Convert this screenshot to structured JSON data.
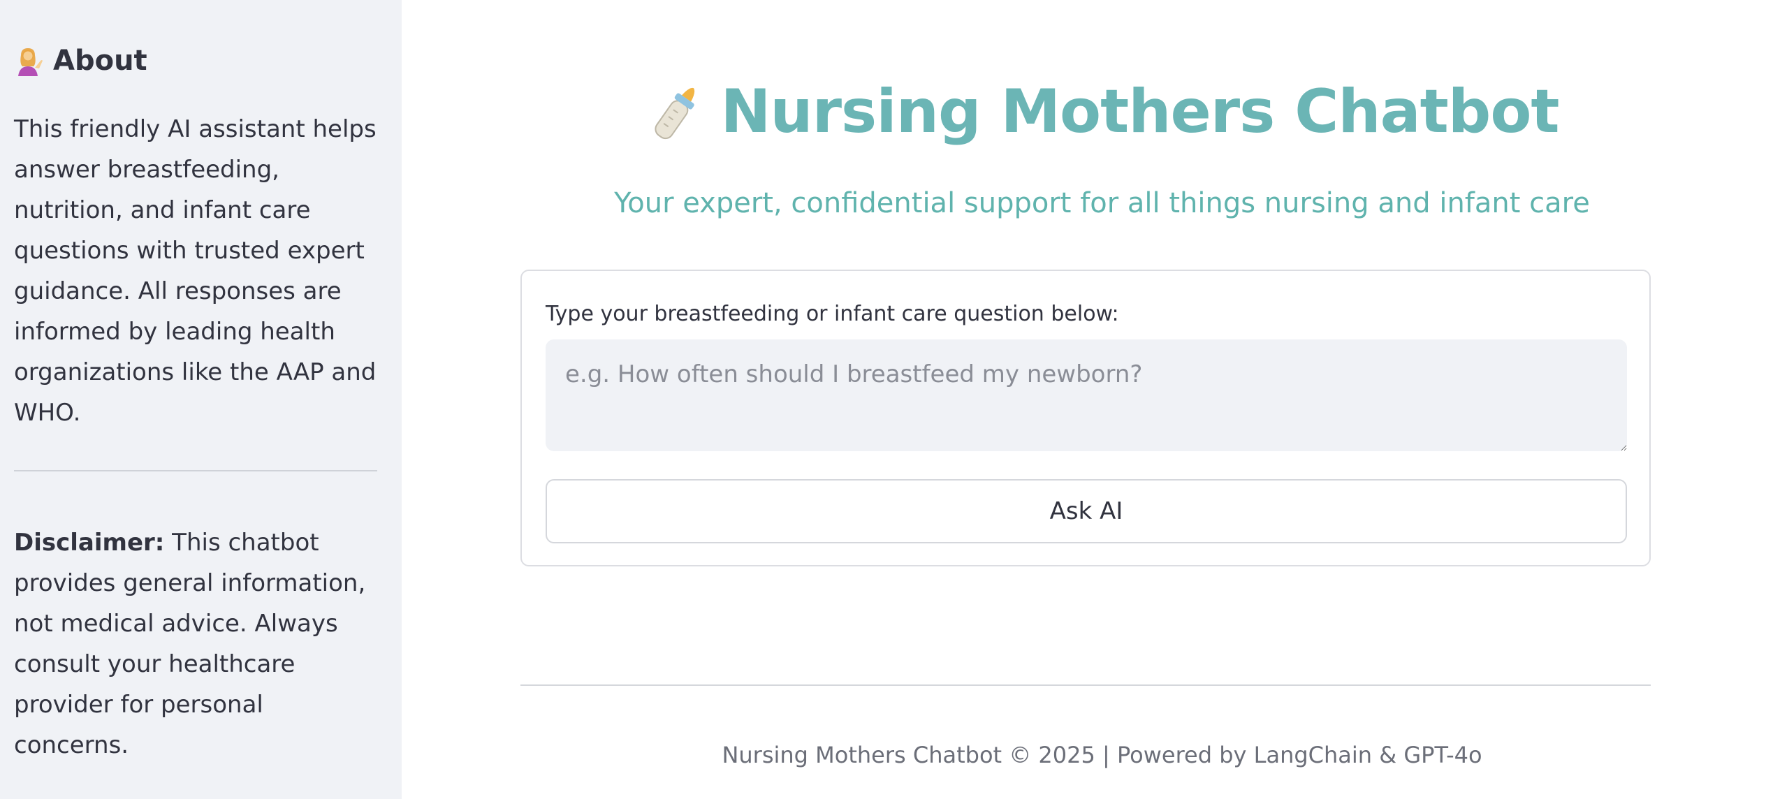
{
  "sidebar": {
    "about_icon": "person-tipping-hand-icon",
    "about_heading": "About",
    "about_text": "This friendly AI assistant helps answer breastfeeding, nutrition, and infant care questions with trusted expert guidance. All responses are informed by leading health organizations like the AAP and WHO.",
    "disclaimer_label": "Disclaimer:",
    "disclaimer_text": " This chatbot provides general information, not medical advice. Always consult your healthcare provider for personal concerns."
  },
  "header": {
    "title_icon": "baby-bottle-icon",
    "title": "Nursing Mothers Chatbot",
    "subtitle": "Your expert, confidential support for all things nursing and infant care"
  },
  "form": {
    "label": "Type your breastfeeding or infant care question below:",
    "placeholder": "e.g. How often should I breastfeed my newborn?",
    "value": "",
    "submit_label": "Ask AI"
  },
  "footer": {
    "text": "Nursing Mothers Chatbot © 2025 | Powered by LangChain & GPT-4o"
  },
  "colors": {
    "accent": "#6bb5b5",
    "sidebar_bg": "#f0f2f6",
    "text": "#31333f"
  }
}
